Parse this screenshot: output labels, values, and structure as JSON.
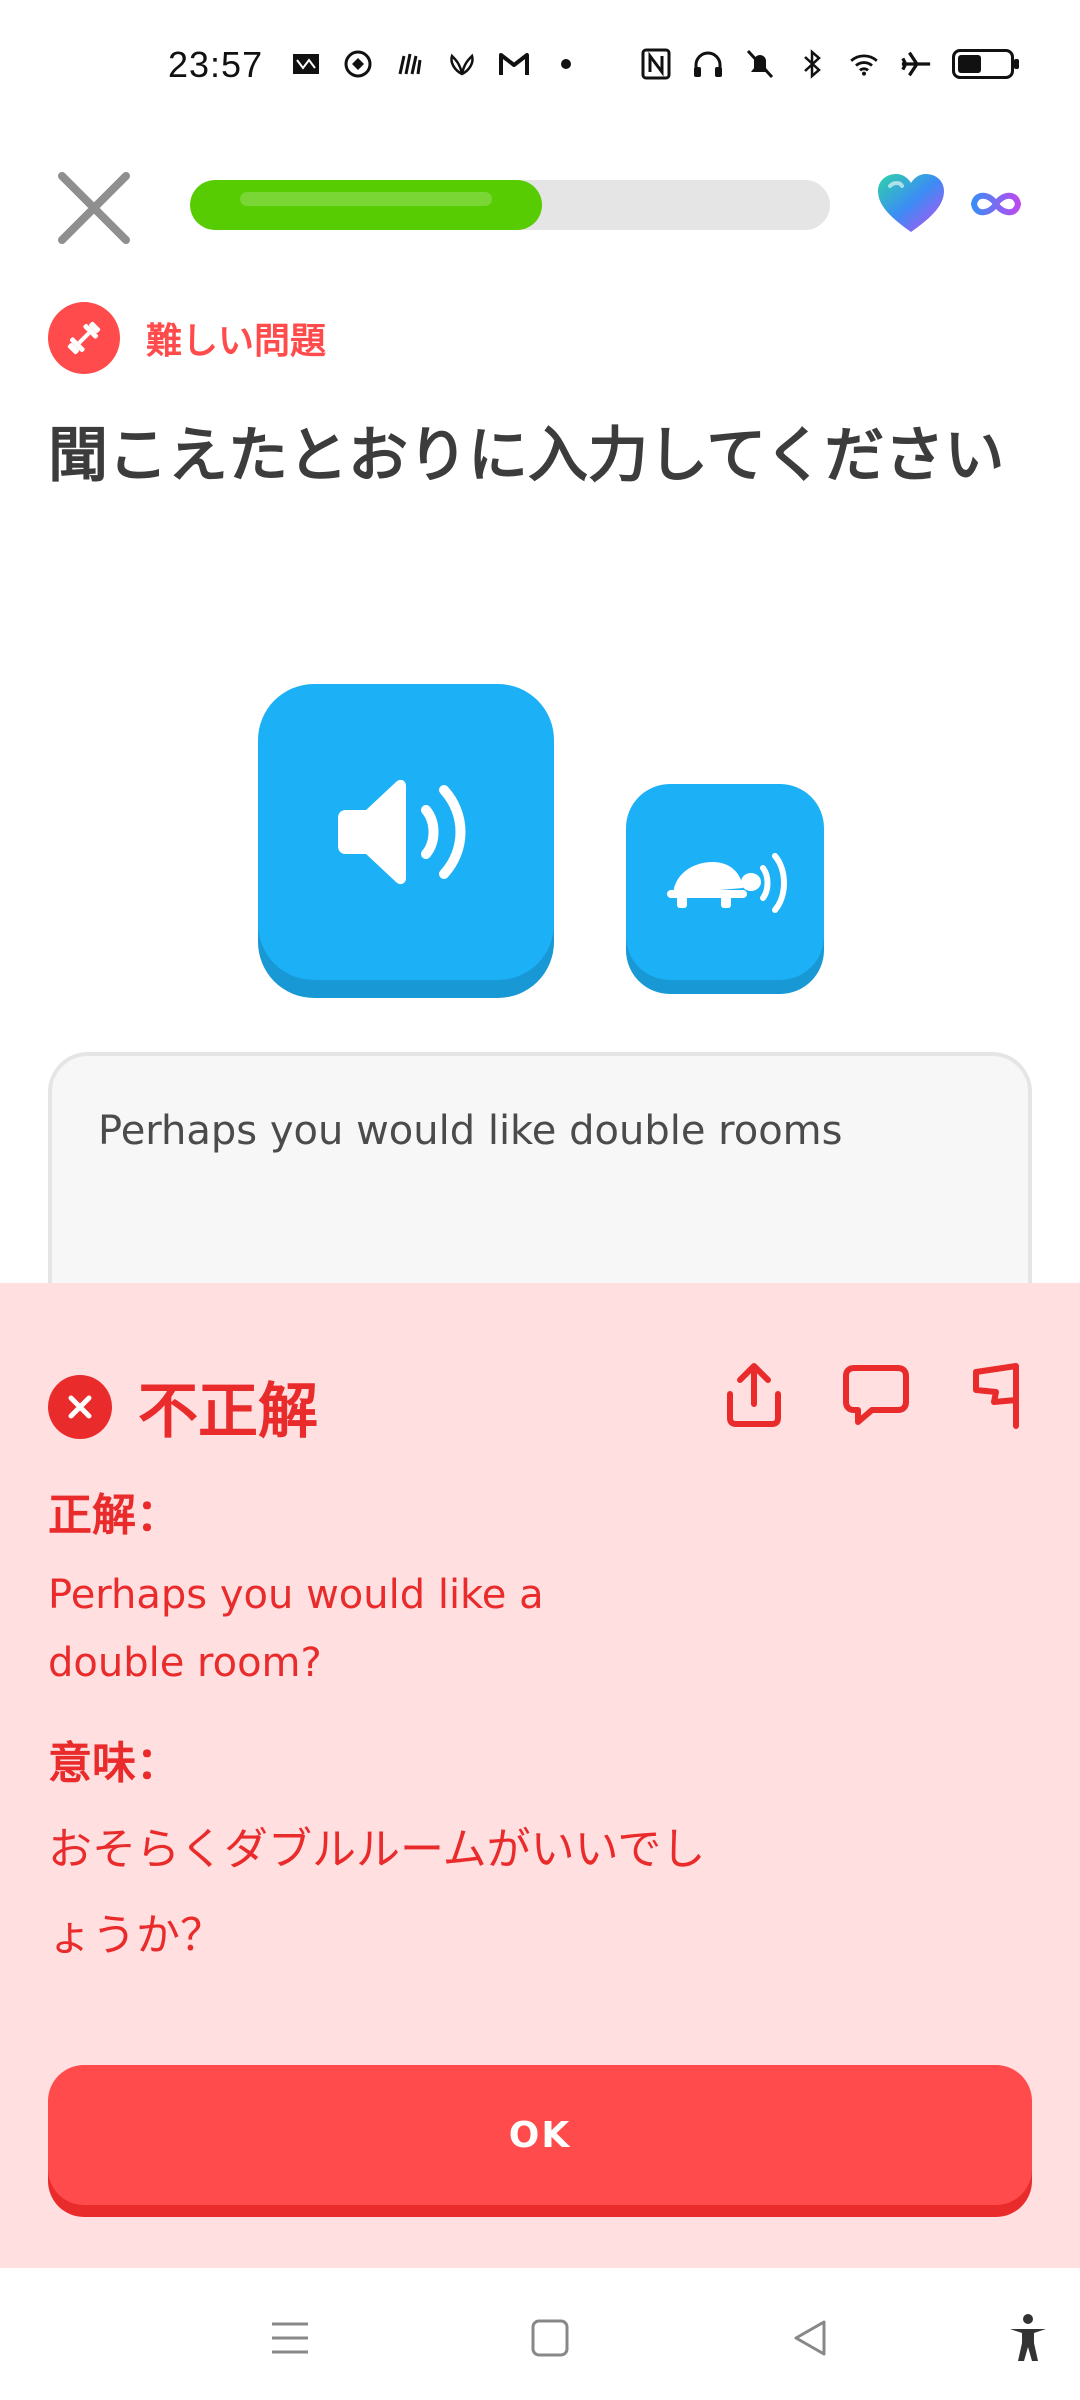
{
  "status_bar": {
    "time": "23:57",
    "left_icons": [
      "nyt-icon",
      "sync-app-icon",
      "hand-app-icon",
      "lotus-app-icon",
      "gmail-icon",
      "dot-icon"
    ],
    "right_icons": [
      "nfc-icon",
      "headphones-icon",
      "bell-off-icon",
      "bluetooth-icon",
      "wifi-icon",
      "airplane-icon",
      "battery-icon"
    ],
    "battery_level": 0.45
  },
  "header": {
    "progress": 0.55,
    "hearts": "infinite"
  },
  "challenge": {
    "badge_label": "難しい問題",
    "title": "聞こえたとおりに入力してください"
  },
  "answer": {
    "text": "Perhaps you would like double rooms"
  },
  "feedback": {
    "result": "不正解",
    "correct_label": "正解：",
    "correct_answer": "Perhaps you would like a double room?",
    "meaning_label": "意味：",
    "meaning": "おそらくダブルルームがいいでしょうか？",
    "ok_label": "OK"
  },
  "colors": {
    "brand_blue": "#1cb0f6",
    "progress_green": "#58cc02",
    "error_red": "#ea2b2b",
    "panel_pink": "#ffdfe0"
  }
}
